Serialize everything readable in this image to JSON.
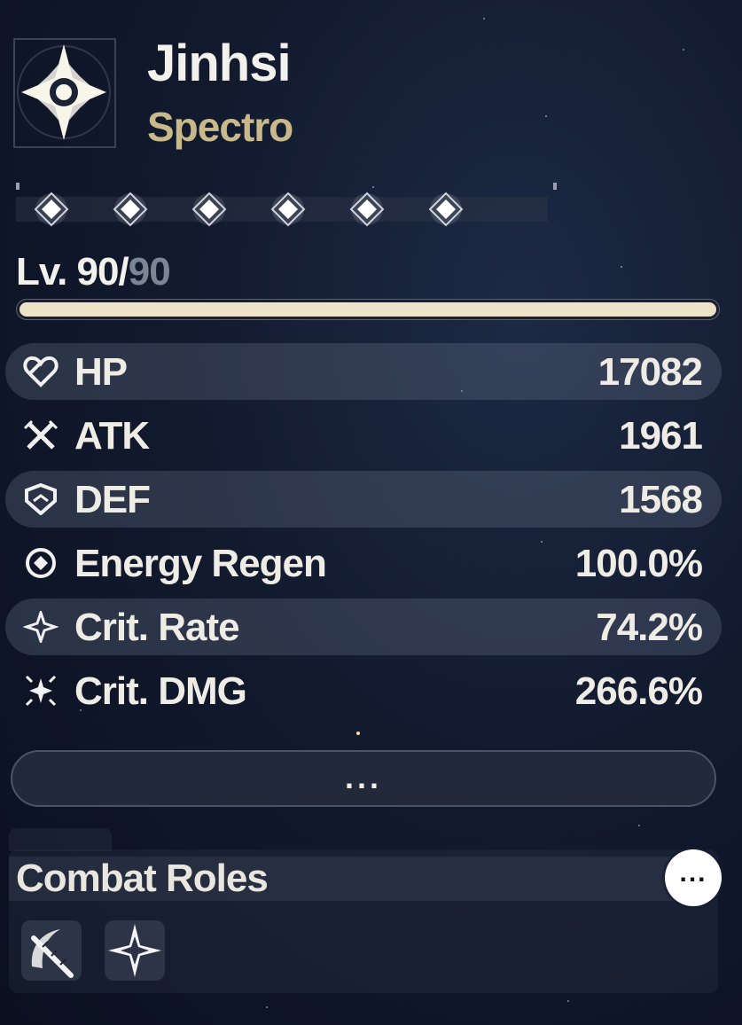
{
  "character": {
    "name": "Jinhsi",
    "element": "Spectro"
  },
  "sequence_nodes": [
    {
      "name": "sequence-node-1",
      "unlocked": true
    },
    {
      "name": "sequence-node-2",
      "unlocked": true
    },
    {
      "name": "sequence-node-3",
      "unlocked": true
    },
    {
      "name": "sequence-node-4",
      "unlocked": true
    },
    {
      "name": "sequence-node-5",
      "unlocked": true
    },
    {
      "name": "sequence-node-6",
      "unlocked": true
    }
  ],
  "level": {
    "prefix": "Lv. ",
    "current": "90",
    "separator": "/",
    "max": "90",
    "progress": 1.0
  },
  "stats": [
    {
      "label": "HP",
      "value": "17082",
      "icon": "heart-icon"
    },
    {
      "label": "ATK",
      "value": "1961",
      "icon": "crossed-swords-icon"
    },
    {
      "label": "DEF",
      "value": "1568",
      "icon": "shield-icon"
    },
    {
      "label": "Energy Regen",
      "value": "100.0%",
      "icon": "energy-regen-icon"
    },
    {
      "label": "Crit. Rate",
      "value": "74.2%",
      "icon": "crit-rate-icon"
    },
    {
      "label": "Crit. DMG",
      "value": "266.6%",
      "icon": "crit-dmg-icon"
    }
  ],
  "more_button": {
    "label": "..."
  },
  "combat_roles": {
    "title": "Combat Roles",
    "info_label": "...",
    "roles": [
      {
        "icon": "blade-role-icon"
      },
      {
        "icon": "sparkle-role-icon"
      }
    ]
  },
  "colors": {
    "accent_gold": "#c9b98a",
    "text_light": "#efece6",
    "level_max": "#7c8593",
    "xp_fill": "#ede3c8"
  }
}
